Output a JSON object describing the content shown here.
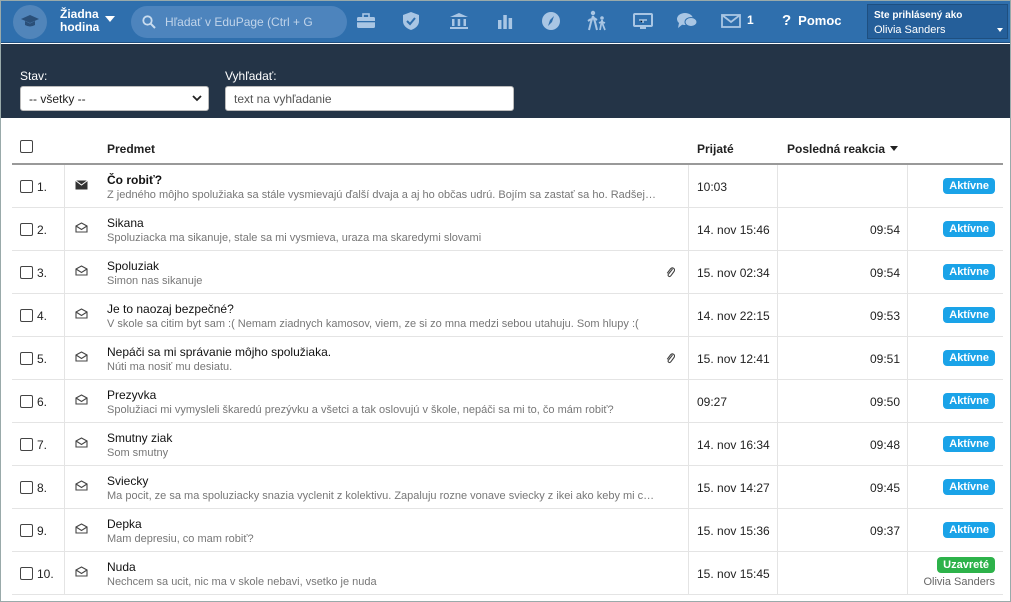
{
  "topbar": {
    "lesson_line1": "Žiadna",
    "lesson_line2": "hodina",
    "search_placeholder": "Hľadať v EduPage (Ctrl + G",
    "icons": [
      "briefcase-icon",
      "shield-icon",
      "bank-icon",
      "bar-chart-icon",
      "compass-icon",
      "family-walk-icon",
      "screen-cast-icon",
      "chat-icon",
      "mail-icon"
    ],
    "mail_count": "1",
    "help_label": "Pomoc",
    "user_logged_label": "Ste prihlásený ako",
    "user_name": "Olivia Sanders"
  },
  "filters": {
    "status_label": "Stav:",
    "status_value": "-- všetky --",
    "search_label": "Vyhľadať:",
    "search_placeholder": "text na vyhľadanie"
  },
  "table": {
    "headers": {
      "subject": "Predmet",
      "received": "Prijaté",
      "last_reaction": "Posledná reakcia"
    },
    "rows": [
      {
        "num": "1.",
        "subject": "Čo robiť?",
        "preview": "Z jedného môjho spolužiaka sa stále vysmievajú ďalší dvaja a aj ho občas udrú. Bojím sa zastať sa ho. Radšej mlčím, aby som nebol ďalší.",
        "received": "10:03",
        "reaction": "",
        "status": "Aktívne",
        "status_type": "active",
        "unread": true,
        "attachment": false,
        "closed_by": ""
      },
      {
        "num": "2.",
        "subject": "Sikana",
        "preview": "Spoluziacka ma sikanuje, stale sa mi vysmieva, uraza ma skaredymi slovami",
        "received": "14. nov 15:46",
        "reaction": "09:54",
        "status": "Aktívne",
        "status_type": "active",
        "unread": false,
        "attachment": false,
        "closed_by": ""
      },
      {
        "num": "3.",
        "subject": "Spoluziak",
        "preview": "Simon nas sikanuje",
        "received": "15. nov 02:34",
        "reaction": "09:54",
        "status": "Aktívne",
        "status_type": "active",
        "unread": false,
        "attachment": true,
        "closed_by": ""
      },
      {
        "num": "4.",
        "subject": "Je to naozaj bezpečné?",
        "preview": "V skole sa citim byt sam :( Nemam ziadnych kamosov, viem, ze si zo mna medzi sebou utahuju. Som hlupy :(",
        "received": "14. nov 22:15",
        "reaction": "09:53",
        "status": "Aktívne",
        "status_type": "active",
        "unread": false,
        "attachment": false,
        "closed_by": ""
      },
      {
        "num": "5.",
        "subject": "Nepáči sa mi správanie môjho spolužiaka.",
        "preview": "Núti ma nosiť mu desiatu.",
        "received": "15. nov 12:41",
        "reaction": "09:51",
        "status": "Aktívne",
        "status_type": "active",
        "unread": false,
        "attachment": true,
        "closed_by": ""
      },
      {
        "num": "6.",
        "subject": "Prezyvka",
        "preview": "Spolužiaci mi vymysleli škaredú prezývku a všetci a tak oslovujú v škole, nepáči sa mi to, čo mám robiť?",
        "received": "09:27",
        "reaction": "09:50",
        "status": "Aktívne",
        "status_type": "active",
        "unread": false,
        "attachment": false,
        "closed_by": ""
      },
      {
        "num": "7.",
        "subject": "Smutny ziak",
        "preview": "Som smutny",
        "received": "14. nov 16:34",
        "reaction": "09:48",
        "status": "Aktívne",
        "status_type": "active",
        "unread": false,
        "attachment": false,
        "closed_by": ""
      },
      {
        "num": "8.",
        "subject": "Sviecky",
        "preview": "Ma pocit, ze sa ma spoluziacky snazia vyclenit z kolektivu. Zapaluju rozne vonave sviecky z ikei ako keby mi chceli naznacit, ze smrdim.",
        "received": "15. nov 14:27",
        "reaction": "09:45",
        "status": "Aktívne",
        "status_type": "active",
        "unread": false,
        "attachment": false,
        "closed_by": ""
      },
      {
        "num": "9.",
        "subject": "Depka",
        "preview": "Mam depresiu, co mam robiť?",
        "received": "15. nov 15:36",
        "reaction": "09:37",
        "status": "Aktívne",
        "status_type": "active",
        "unread": false,
        "attachment": false,
        "closed_by": ""
      },
      {
        "num": "10.",
        "subject": "Nuda",
        "preview": "Nechcem sa ucit, nic ma v skole nebavi, vsetko je nuda",
        "received": "15. nov 15:45",
        "reaction": "",
        "status": "Uzavreté",
        "status_type": "closed",
        "unread": false,
        "attachment": false,
        "closed_by": "Olivia Sanders"
      }
    ]
  },
  "colors": {
    "topbar": "#2f6fad",
    "filterbar": "#243447",
    "active_badge": "#1aa3e8",
    "closed_badge": "#2db24a"
  }
}
